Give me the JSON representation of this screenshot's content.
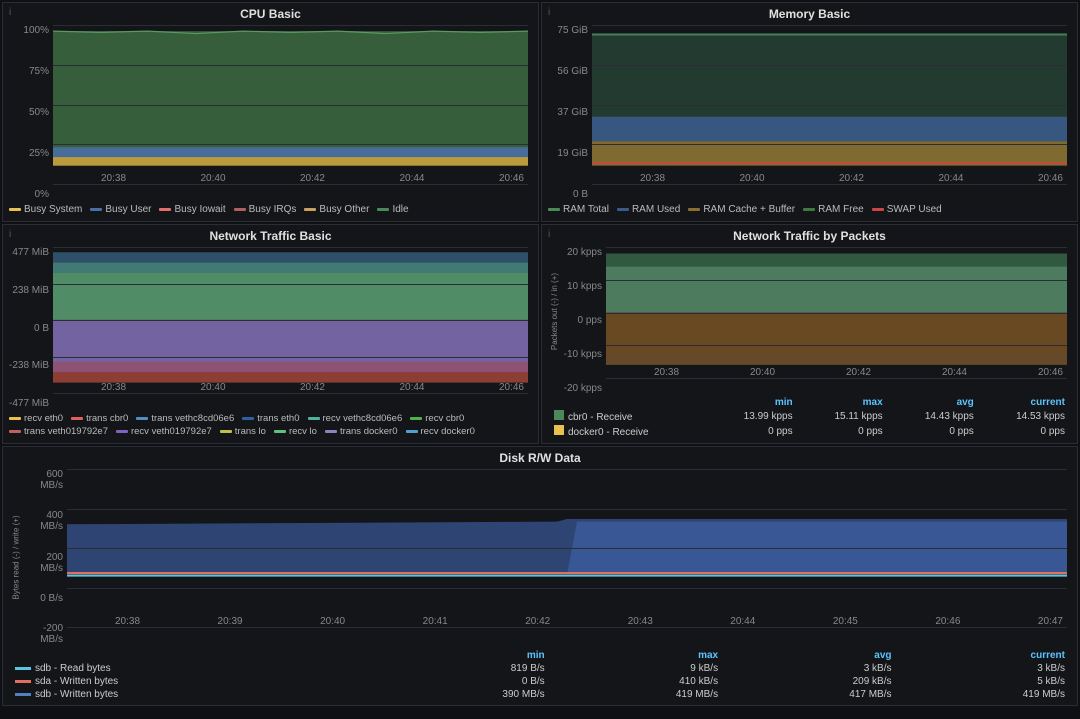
{
  "panels": {
    "cpu": {
      "title": "CPU Basic",
      "yLabels": [
        "100%",
        "75%",
        "50%",
        "25%",
        "0%"
      ],
      "xLabels": [
        "20:38",
        "20:40",
        "20:42",
        "20:44",
        "20:46"
      ],
      "legend": [
        {
          "label": "Busy System",
          "color": "#e8c14e",
          "type": "line"
        },
        {
          "label": "Busy User",
          "color": "#3e7bb5",
          "type": "line"
        },
        {
          "label": "Busy Iowait",
          "color": "#e07070",
          "type": "line"
        },
        {
          "label": "Busy IRQs",
          "color": "#b06060",
          "type": "line"
        },
        {
          "label": "Busy Other",
          "color": "#c8a060",
          "type": "line"
        },
        {
          "label": "Idle",
          "color": "#4a8a5a",
          "type": "line"
        }
      ]
    },
    "memory": {
      "title": "Memory Basic",
      "yLabels": [
        "75 GiB",
        "56 GiB",
        "37 GiB",
        "19 GiB",
        "0 B"
      ],
      "xLabels": [
        "20:38",
        "20:40",
        "20:42",
        "20:44",
        "20:46"
      ],
      "legend": [
        {
          "label": "RAM Total",
          "color": "#4a8a5a",
          "type": "line"
        },
        {
          "label": "RAM Used",
          "color": "#3e6ba0",
          "type": "line"
        },
        {
          "label": "RAM Cache + Buffer",
          "color": "#c0a050",
          "type": "line"
        },
        {
          "label": "RAM Free",
          "color": "#3e7b3e",
          "type": "line"
        },
        {
          "label": "SWAP Used",
          "color": "#cc4444",
          "type": "line"
        }
      ]
    },
    "network": {
      "title": "Network Traffic Basic",
      "yLabels": [
        "477 MiB",
        "238 MiB",
        "0 B",
        "-238 MiB",
        "-477 MiB"
      ],
      "xLabels": [
        "20:38",
        "20:40",
        "20:42",
        "20:44",
        "20:46"
      ],
      "legend": [
        {
          "label": "recv eth0",
          "color": "#e8c14e"
        },
        {
          "label": "trans cbr0",
          "color": "#e06060"
        },
        {
          "label": "trans vethc8cd06e6",
          "color": "#5090c0"
        },
        {
          "label": "trans eth0",
          "color": "#3060a0"
        },
        {
          "label": "recv vethc8cd06e6",
          "color": "#50b0a0"
        },
        {
          "label": "recv cbr0",
          "color": "#50b050"
        },
        {
          "label": "trans veth019792e7",
          "color": "#c06060"
        },
        {
          "label": "recv veth019792e7",
          "color": "#8060c0"
        },
        {
          "label": "trans lo",
          "color": "#c0c050"
        },
        {
          "label": "recv lo",
          "color": "#60c080"
        },
        {
          "label": "trans docker0",
          "color": "#9080c0"
        },
        {
          "label": "recv docker0",
          "color": "#50a0d0"
        }
      ]
    },
    "packets": {
      "title": "Network Traffic by Packets",
      "yAxisLabel": "Packets out (-) / in (+)",
      "yLabels": [
        "20 kpps",
        "10 kpps",
        "0 pps",
        "-10 kpps",
        "-20 kpps"
      ],
      "xLabels": [
        "20:38",
        "20:40",
        "20:42",
        "20:44",
        "20:46"
      ],
      "tableHeaders": [
        "",
        "min",
        "max",
        "avg",
        "current"
      ],
      "tableRows": [
        {
          "label": "cbr0 - Receive",
          "color": "#4a8a5a",
          "min": "13.99 kpps",
          "max": "15.11 kpps",
          "avg": "14.43 kpps",
          "current": "14.53 kpps"
        },
        {
          "label": "docker0 - Receive",
          "color": "#e8c14e",
          "min": "0 pps",
          "max": "0 pps",
          "avg": "0 pps",
          "current": "0 pps"
        }
      ]
    },
    "disk": {
      "title": "Disk R/W Data",
      "yAxisLabel": "Bytes read (-) / write (+)",
      "yLabels": [
        "600 MB/s",
        "400 MB/s",
        "200 MB/s",
        "0 B/s",
        "-200 MB/s"
      ],
      "xLabels": [
        "20:38",
        "20:39",
        "20:40",
        "20:41",
        "20:42",
        "20:43",
        "20:44",
        "20:45",
        "20:46",
        "20:47"
      ],
      "tableRows": [
        {
          "label": "sdb - Read bytes",
          "color": "#5bc4e0",
          "min": "819 B/s",
          "max": "9 kB/s",
          "avg": "3 kB/s",
          "current": "3 kB/s"
        },
        {
          "label": "sda - Written bytes",
          "color": "#e07060",
          "min": "0 B/s",
          "max": "410 kB/s",
          "avg": "209 kB/s",
          "current": "5 kB/s"
        },
        {
          "label": "sdb - Written bytes",
          "color": "#5080c0",
          "min": "390 MB/s",
          "max": "419 MB/s",
          "avg": "417 MB/s",
          "current": "419 MB/s"
        }
      ]
    }
  }
}
